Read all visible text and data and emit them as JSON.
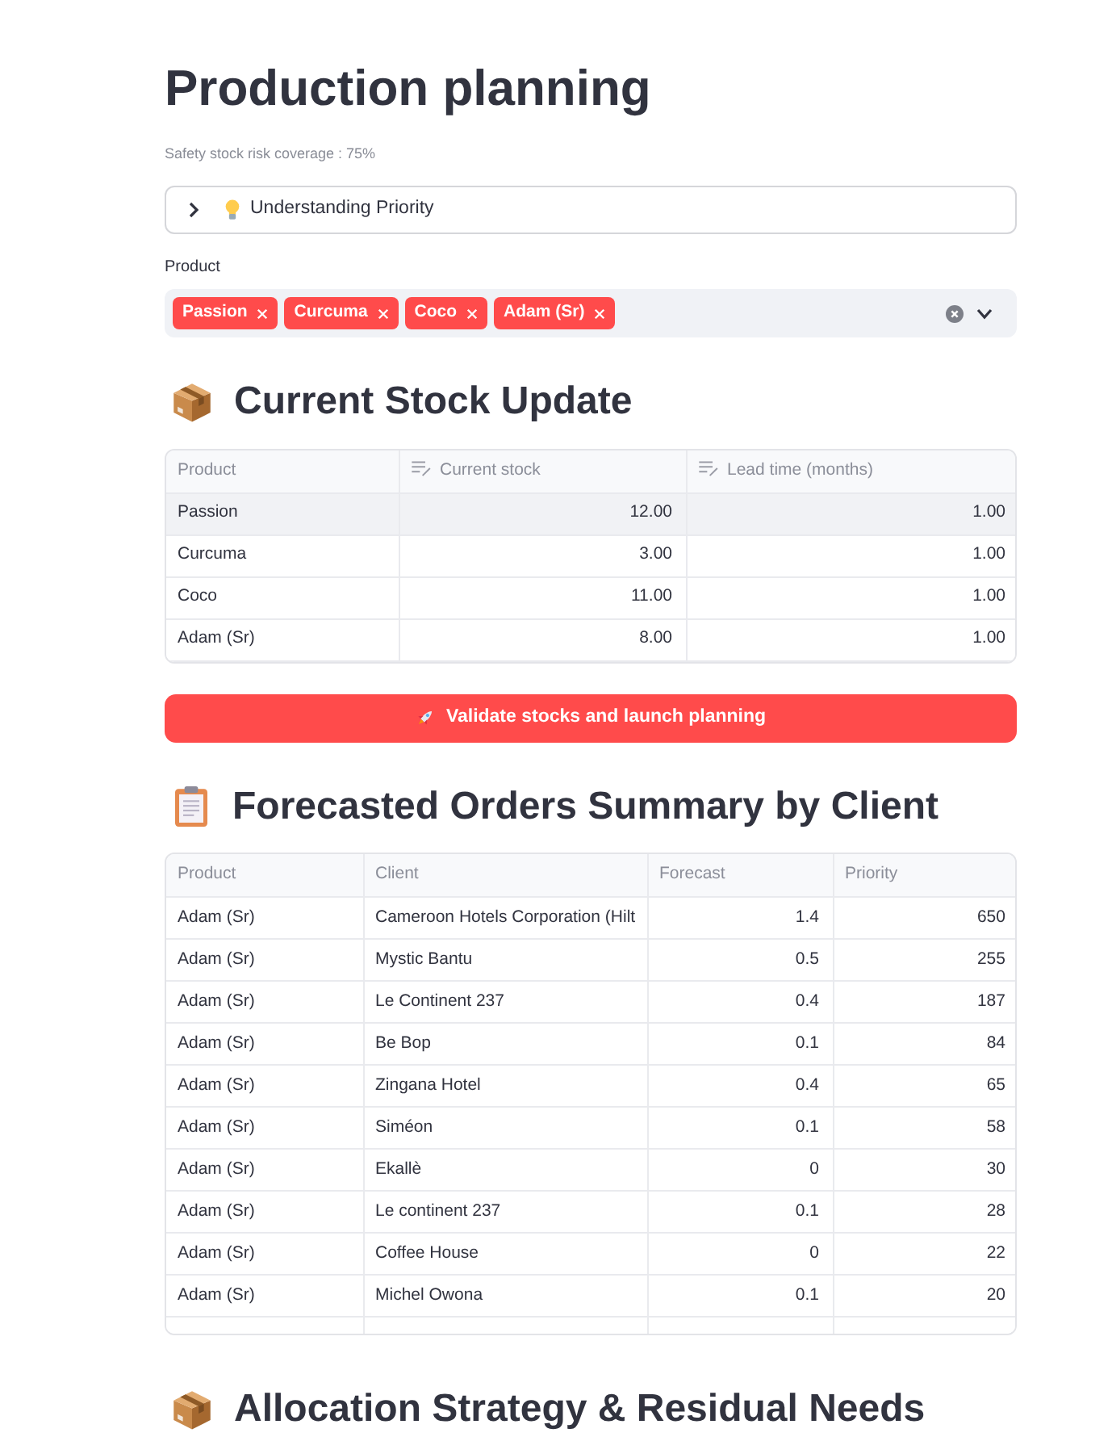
{
  "page": {
    "title": "Production planning",
    "caption": "Safety stock risk coverage : 75%"
  },
  "expander": {
    "label": "Understanding Priority",
    "expanded": false
  },
  "product_filter": {
    "label": "Product",
    "selected_tags": [
      "Passion",
      "Curcuma",
      "Coco",
      "Adam (Sr)"
    ]
  },
  "stock_update": {
    "title": "Current Stock Update",
    "table": {
      "columns": [
        {
          "label": "Product",
          "kind": "text",
          "editable": false
        },
        {
          "label": "Current stock",
          "kind": "number",
          "editable": true
        },
        {
          "label": "Lead time (months)",
          "kind": "number",
          "editable": true
        }
      ],
      "rows": [
        {
          "cells": [
            "Passion",
            "12.00",
            "1.00"
          ],
          "highlighted": true
        },
        {
          "cells": [
            "Curcuma",
            "3.00",
            "1.00"
          ],
          "highlighted": false
        },
        {
          "cells": [
            "Coco",
            "11.00",
            "1.00"
          ],
          "highlighted": false
        },
        {
          "cells": [
            "Adam (Sr)",
            "8.00",
            "1.00"
          ],
          "highlighted": false
        }
      ]
    }
  },
  "launch_button": {
    "label": "Validate stocks and launch planning"
  },
  "forecast_summary": {
    "title": "Forecasted Orders Summary by Client",
    "table": {
      "columns": [
        {
          "label": "Product",
          "kind": "text"
        },
        {
          "label": "Client",
          "kind": "text"
        },
        {
          "label": "Forecast",
          "kind": "number"
        },
        {
          "label": "Priority",
          "kind": "number"
        }
      ],
      "rows": [
        {
          "cells": [
            "Adam (Sr)",
            "Cameroon Hotels Corporation (Hilt",
            "1.4",
            "650"
          ]
        },
        {
          "cells": [
            "Adam (Sr)",
            "Mystic Bantu",
            "0.5",
            "255"
          ]
        },
        {
          "cells": [
            "Adam (Sr)",
            "Le Continent 237",
            "0.4",
            "187"
          ]
        },
        {
          "cells": [
            "Adam (Sr)",
            "Be Bop",
            "0.1",
            "84"
          ]
        },
        {
          "cells": [
            "Adam (Sr)",
            "Zingana Hotel",
            "0.4",
            "65"
          ]
        },
        {
          "cells": [
            "Adam (Sr)",
            "Siméon",
            "0.1",
            "58"
          ]
        },
        {
          "cells": [
            "Adam (Sr)",
            "Ekallè",
            "0",
            "30"
          ]
        },
        {
          "cells": [
            "Adam (Sr)",
            "Le continent 237",
            "0.1",
            "28"
          ]
        },
        {
          "cells": [
            "Adam (Sr)",
            "Coffee House",
            "0",
            "22"
          ]
        },
        {
          "cells": [
            "Adam (Sr)",
            "Michel Owona",
            "0.1",
            "20"
          ]
        }
      ]
    }
  },
  "allocation": {
    "title": "Allocation Strategy & Residual Needs"
  }
}
